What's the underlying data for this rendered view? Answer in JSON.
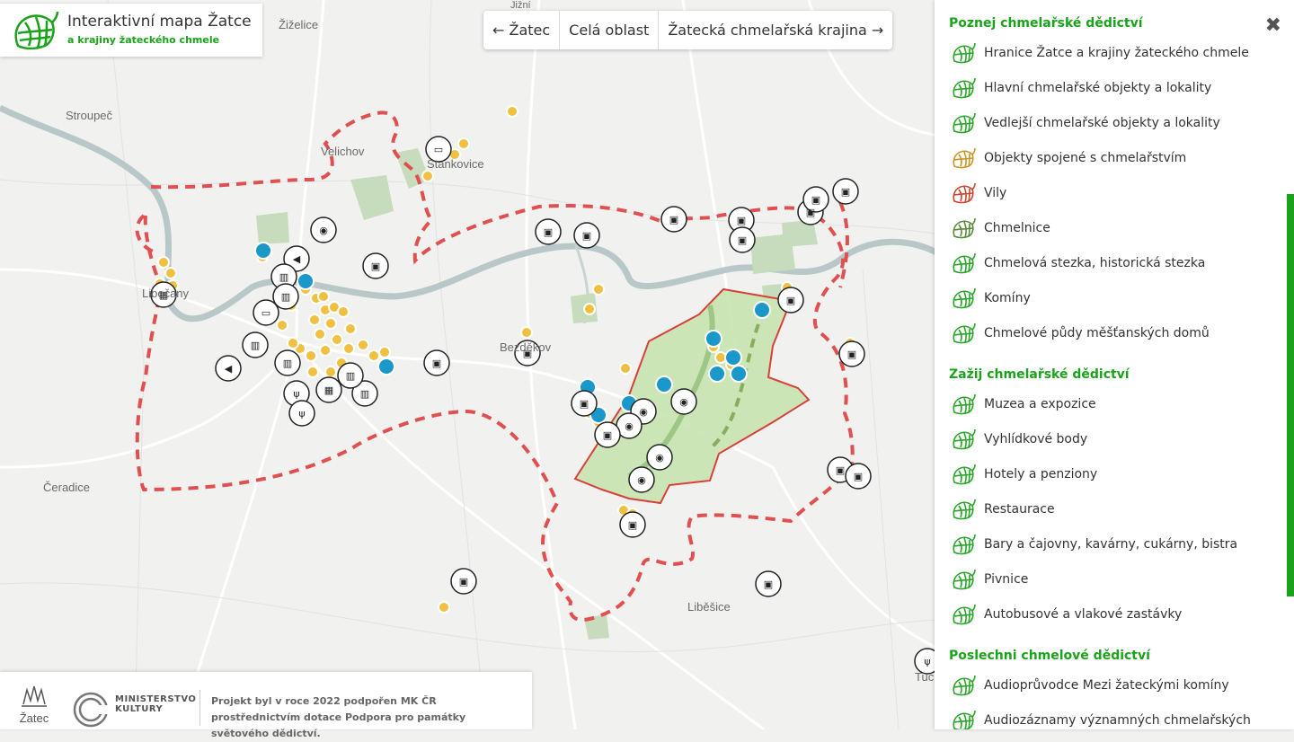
{
  "app": {
    "title": "Interaktivní mapa Žatce",
    "subtitle": "a krajiny žateckého chmele"
  },
  "nav": {
    "prev_label": "← Žatec",
    "all_label": "Celá oblast",
    "next_label": "Žatecká chmelařská krajina →"
  },
  "map": {
    "places": [
      "Žiželice",
      "Stroupeč",
      "Velichov",
      "Stankovice",
      "Čeradice",
      "Bezděkov",
      "Liběšice",
      "Tuchořice",
      "Libočany",
      "Jižní"
    ]
  },
  "sidebar": {
    "sections": [
      {
        "title": "Poznej chmelařské dědictví",
        "items": [
          {
            "label": "Hranice Žatce a krajiny žateckého chmele",
            "color": "#2aa52a"
          },
          {
            "label": "Hlavní chmelařské objekty a lokality",
            "color": "#2aa52a"
          },
          {
            "label": "Vedlejší chmelařské objekty a lokality",
            "color": "#2aa52a"
          },
          {
            "label": "Objekty spojené s chmelařstvím",
            "color": "#c9962a"
          },
          {
            "label": "Vily",
            "color": "#c9452f"
          },
          {
            "label": "Chmelnice",
            "color": "#5a8a3a"
          },
          {
            "label": "Chmelová stezka, historická stezka",
            "color": "#2aa52a"
          },
          {
            "label": "Komíny",
            "color": "#2aa52a"
          },
          {
            "label": "Chmelové půdy měšťanských domů",
            "color": "#2aa52a"
          }
        ]
      },
      {
        "title": "Zažij chmelařské dědictví",
        "items": [
          {
            "label": "Muzea a expozice",
            "color": "#2aa52a"
          },
          {
            "label": "Vyhlídkové body",
            "color": "#2aa52a"
          },
          {
            "label": "Hotely a penziony",
            "color": "#2aa52a"
          },
          {
            "label": "Restaurace",
            "color": "#2aa52a"
          },
          {
            "label": "Bary a čajovny, kavárny, cukárny, bistra",
            "color": "#2aa52a"
          },
          {
            "label": "Pivnice",
            "color": "#2aa52a"
          },
          {
            "label": "Autobusové a vlakové zastávky",
            "color": "#2aa52a"
          }
        ]
      },
      {
        "title": "Poslechni chmelové dědictví",
        "items": [
          {
            "label": "Audioprůvodce Mezi žateckými komíny",
            "color": "#2aa52a"
          },
          {
            "label": "Audiozáznamy významných chmelařských",
            "color": "#2aa52a"
          }
        ]
      }
    ]
  },
  "footer": {
    "logo_text": "Žatec",
    "ministry": "MINISTERSTVO",
    "ministry2": "KULTURY",
    "text": "Projekt byl v roce 2022 podpořen MK ČR prostřednictvím dotace Podpora pro památky světového dědictví."
  },
  "colors": {
    "accent": "#1aa31a",
    "boundary": "#e05050",
    "poi_yellow": "#f0c040",
    "poi_blue": "#1a98c9"
  }
}
